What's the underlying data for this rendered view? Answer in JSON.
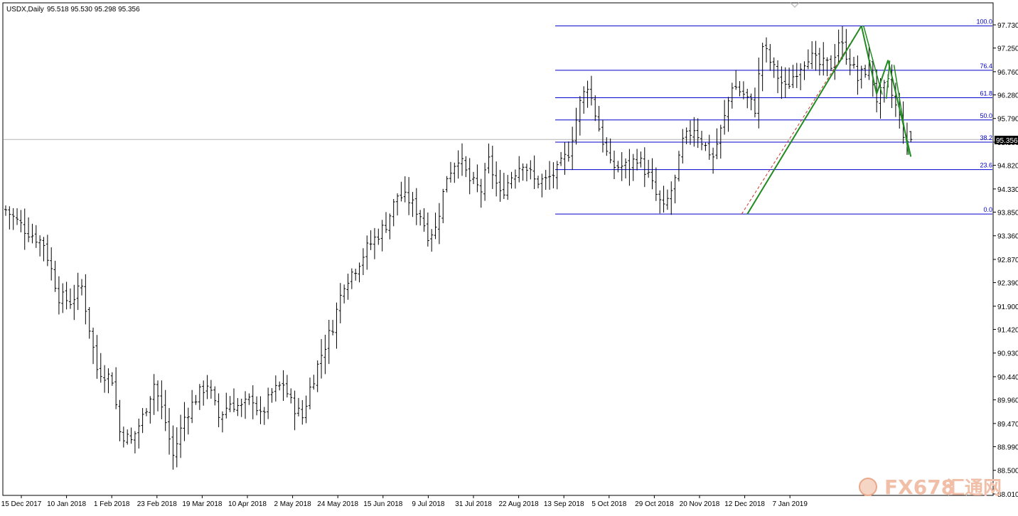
{
  "header": {
    "symbol_label": "USDX,Daily",
    "ohlc": "95.518 95.530 95.298 95.356"
  },
  "current_price_label": "95.356",
  "watermark": {
    "text_latin": "FX678",
    "text_cjk": "汇通网"
  },
  "colors": {
    "bar": "#000000",
    "fib_line": "#0000cc",
    "fib_label": "#0000cc",
    "pattern": "#228b22",
    "dashed_trend": "#cc3333",
    "price_line": "#b4b4b4",
    "axis": "#000000",
    "background": "#ffffff"
  },
  "chart_data": {
    "type": "ohlc",
    "title": "USDX,Daily",
    "timeframe": "Daily",
    "last_bar": {
      "open": 95.518,
      "high": 95.53,
      "low": 95.298,
      "close": 95.356
    },
    "y_tick_labels": [
      "97.730",
      "97.250",
      "96.760",
      "96.280",
      "95.790",
      "95.300",
      "94.820",
      "94.330",
      "93.850",
      "93.360",
      "92.870",
      "92.390",
      "91.900",
      "91.420",
      "90.930",
      "90.440",
      "89.960",
      "89.470",
      "88.990",
      "88.500",
      "88.010"
    ],
    "ylim": [
      88.01,
      97.9
    ],
    "x_tick_labels": [
      "15 Dec 2017",
      "10 Jan 2018",
      "1 Feb 2018",
      "23 Feb 2018",
      "19 Mar 2018",
      "10 Apr 2018",
      "2 May 2018",
      "24 May 2018",
      "15 Jun 2018",
      "9 Jul 2018",
      "31 Jul 2018",
      "22 Aug 2018",
      "13 Sep 2018",
      "5 Oct 2018",
      "29 Oct 2018",
      "20 Nov 2018",
      "12 Dec 2018",
      "7 Jan 2019"
    ],
    "close_path": [
      [
        0,
        93.9
      ],
      [
        5,
        93.5
      ],
      [
        10,
        93.2
      ],
      [
        14,
        92.1
      ],
      [
        17,
        92.0
      ],
      [
        20,
        92.3
      ],
      [
        24,
        90.6
      ],
      [
        28,
        90.4
      ],
      [
        30,
        89.3
      ],
      [
        33,
        89.1
      ],
      [
        36,
        89.6
      ],
      [
        39,
        90.3
      ],
      [
        42,
        89.5
      ],
      [
        44,
        88.8
      ],
      [
        47,
        89.6
      ],
      [
        50,
        90.0
      ],
      [
        53,
        90.3
      ],
      [
        56,
        89.6
      ],
      [
        59,
        89.9
      ],
      [
        62,
        89.8
      ],
      [
        65,
        90.0
      ],
      [
        67,
        89.6
      ],
      [
        70,
        90.1
      ],
      [
        73,
        90.3
      ],
      [
        75,
        89.9
      ],
      [
        78,
        89.6
      ],
      [
        80,
        90.2
      ],
      [
        83,
        90.9
      ],
      [
        86,
        91.5
      ],
      [
        89,
        92.4
      ],
      [
        92,
        92.7
      ],
      [
        95,
        93.1
      ],
      [
        98,
        93.4
      ],
      [
        100,
        93.6
      ],
      [
        103,
        94.2
      ],
      [
        106,
        94.1
      ],
      [
        109,
        93.8
      ],
      [
        111,
        93.4
      ],
      [
        113,
        93.5
      ],
      [
        116,
        94.6
      ],
      [
        119,
        95.0
      ],
      [
        122,
        94.5
      ],
      [
        125,
        94.3
      ],
      [
        127,
        94.9
      ],
      [
        130,
        94.2
      ],
      [
        133,
        94.6
      ],
      [
        136,
        94.9
      ],
      [
        139,
        94.5
      ],
      [
        142,
        94.5
      ],
      [
        145,
        94.7
      ],
      [
        148,
        95.1
      ],
      [
        151,
        96.1
      ],
      [
        153,
        96.5
      ],
      [
        156,
        95.6
      ],
      [
        159,
        94.8
      ],
      [
        161,
        94.8
      ],
      [
        164,
        94.8
      ],
      [
        166,
        95.0
      ],
      [
        169,
        94.6
      ],
      [
        171,
        94.2
      ],
      [
        173,
        93.9
      ],
      [
        176,
        94.5
      ],
      [
        178,
        95.3
      ],
      [
        181,
        95.6
      ],
      [
        184,
        95.2
      ],
      [
        186,
        95.0
      ],
      [
        189,
        95.8
      ],
      [
        191,
        96.5
      ],
      [
        194,
        96.3
      ],
      [
        197,
        96.0
      ],
      [
        199,
        97.3
      ],
      [
        202,
        96.8
      ],
      [
        205,
        96.4
      ],
      [
        208,
        96.8
      ],
      [
        211,
        97.1
      ],
      [
        214,
        96.9
      ],
      [
        217,
        96.9
      ],
      [
        219,
        97.4
      ],
      [
        222,
        97.0
      ],
      [
        224,
        96.6
      ],
      [
        227,
        96.9
      ],
      [
        229,
        96.2
      ],
      [
        232,
        96.5
      ],
      [
        235,
        95.8
      ],
      [
        237,
        95.2
      ],
      [
        238,
        95.36
      ]
    ],
    "fibonacci": {
      "start_date": "13 Sep 2018",
      "end_date": "12 Dec 2018",
      "price_low": 93.81,
      "price_high": 97.71,
      "levels": [
        {
          "ratio": 0.0,
          "label": "0.0"
        },
        {
          "ratio": 0.236,
          "label": "23.6"
        },
        {
          "ratio": 0.382,
          "label": "38.2"
        },
        {
          "ratio": 0.5,
          "label": "50.0"
        },
        {
          "ratio": 0.618,
          "label": "61.8"
        },
        {
          "ratio": 0.764,
          "label": "76.4"
        },
        {
          "ratio": 1.0,
          "label": "100.0"
        }
      ]
    },
    "harmonic_pattern_points": [
      [
        195,
        93.81
      ],
      [
        225,
        97.71
      ],
      [
        229,
        96.3
      ],
      [
        232,
        97.0
      ],
      [
        238,
        95.0
      ]
    ],
    "grid": false
  }
}
